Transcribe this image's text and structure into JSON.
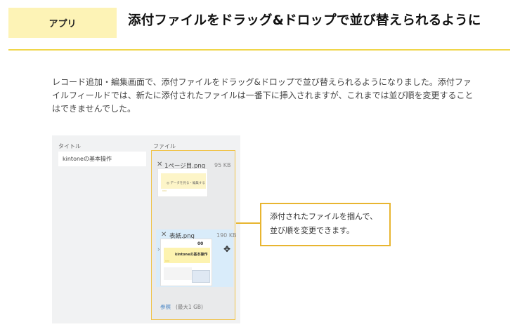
{
  "header": {
    "badge": "アプリ",
    "title": "添付ファイルをドラッグ&ドロップで並び替えられるように"
  },
  "colors": {
    "accent_yellow": "#f0d64a",
    "badge_bg": "#fdf3b6",
    "callout_border": "#e8b530",
    "link_blue": "#4a86c5"
  },
  "description": "レコード追加・編集画面で、添付ファイルをドラッグ&ドロップで並び替えられるようになりました。添付ファイルフィールドでは、新たに添付されたファイルは一番下に挿入されますが、これまでは並び順を変更することはできませんでした。",
  "screenshot": {
    "title_label": "タイトル",
    "title_value": "kintoneの基本操作",
    "file_label": "ファイル",
    "files": [
      {
        "name": "1ページ目.png",
        "size": "95 KB",
        "remove_icon": "close-icon",
        "thumb_text": "◎ データを見る・編集する",
        "thumb_sub": "ᵔᵔᵔ"
      },
      {
        "name": "表紙.png",
        "size": "190 KB",
        "remove_icon": "close-icon",
        "thumb_title": "kintoneの基本操作",
        "thumb_number": "00",
        "thumb_sub": "ᵔᵔᵔ"
      }
    ],
    "move_icon": "move-cursor-icon",
    "browse_label": "参照",
    "max_size": "(最大1 GB)"
  },
  "callout": {
    "line1": "添付されたファイルを掴んで、",
    "line2": "並び順を変更できます。"
  }
}
